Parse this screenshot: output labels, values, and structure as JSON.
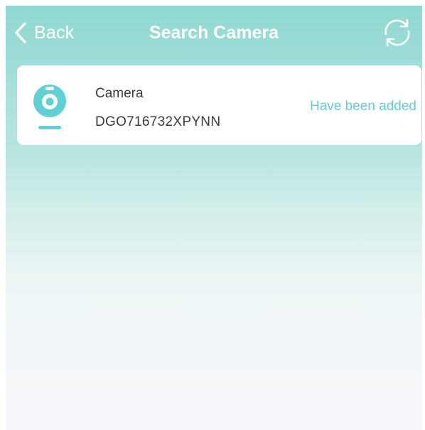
{
  "header": {
    "back_label": "Back",
    "title": "Search Camera",
    "back_icon": "chevron-left-icon",
    "refresh_icon": "refresh-icon"
  },
  "devices": [
    {
      "name": "Camera",
      "id": "DGO716732XPYNN",
      "status": "Have been added",
      "icon": "camera-icon"
    }
  ],
  "colors": {
    "accent": "#5fd0d3",
    "header_gradient_top": "#8fd8d1",
    "background": "#f4f6f9",
    "text": "#3a3a3a"
  }
}
